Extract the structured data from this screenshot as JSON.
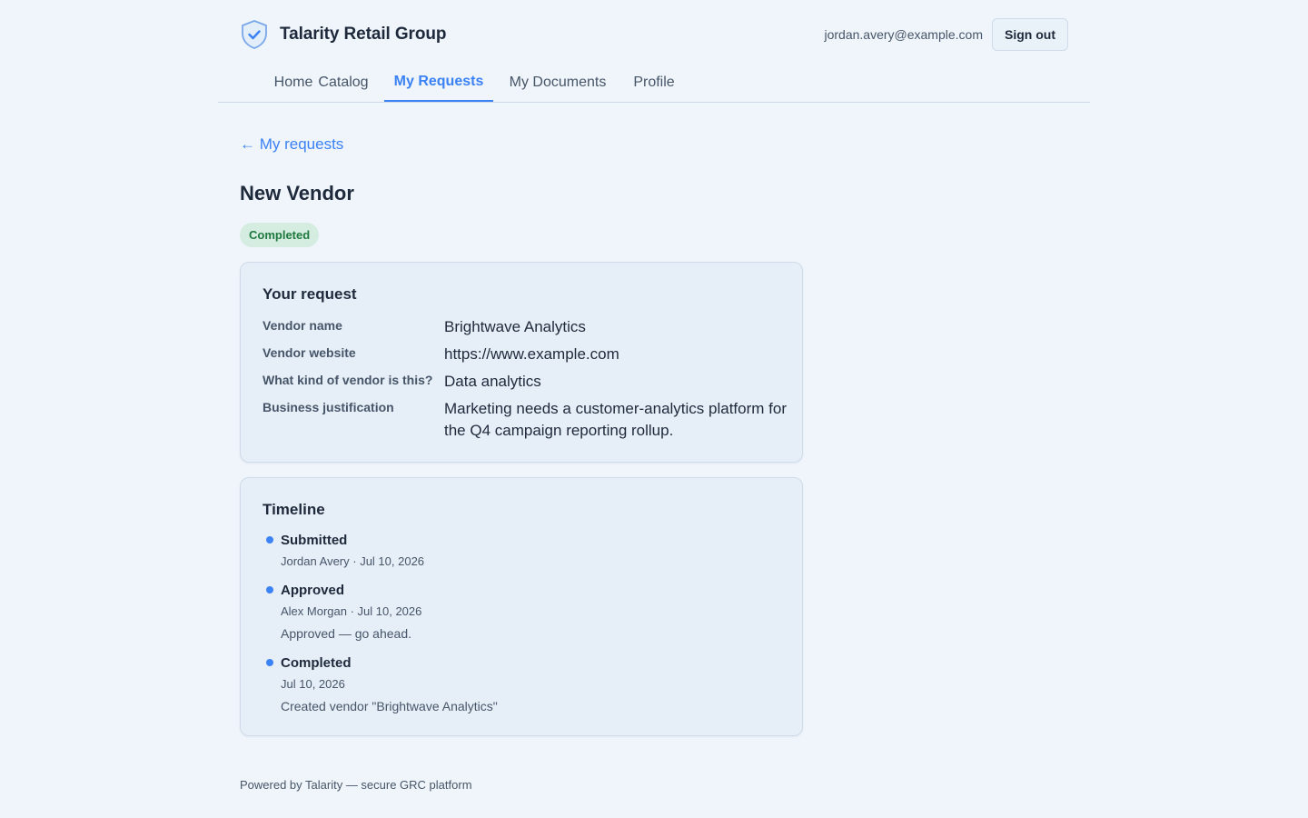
{
  "brand": {
    "name": "Talarity Retail Group",
    "icon": "shield-check-icon",
    "accent": "#3b82f6"
  },
  "user": {
    "email": "jordan.avery@example.com",
    "signout_label": "Sign out"
  },
  "nav": {
    "tabs": [
      {
        "label": "Home",
        "active": false
      },
      {
        "label": "Catalog",
        "active": false
      },
      {
        "label": "My Requests",
        "active": true
      },
      {
        "label": "My Documents",
        "active": false
      },
      {
        "label": "Profile",
        "active": false
      }
    ]
  },
  "back_link": "← My requests",
  "page": {
    "title": "New Vendor",
    "status": "Completed",
    "status_color": "#1f7a3f"
  },
  "request": {
    "title": "Your request",
    "fields": [
      {
        "label": "Vendor name",
        "value": "Brightwave Analytics"
      },
      {
        "label": "Vendor website",
        "value": "https://www.example.com"
      },
      {
        "label": "What kind of vendor is this?",
        "value": "Data analytics"
      },
      {
        "label": "Business justification",
        "value": "Marketing needs a customer-analytics platform for the Q4 campaign reporting rollup."
      }
    ]
  },
  "timeline": {
    "title": "Timeline",
    "events": [
      {
        "title": "Submitted",
        "meta": "Jordan Avery · Jul 10, 2026",
        "note": ""
      },
      {
        "title": "Approved",
        "meta": "Alex Morgan · Jul 10, 2026",
        "note": "Approved — go ahead."
      },
      {
        "title": "Completed",
        "meta": "Jul 10, 2026",
        "note": "Created vendor \"Brightwave Analytics\""
      }
    ]
  },
  "footer": "Powered by Talarity — secure GRC platform"
}
